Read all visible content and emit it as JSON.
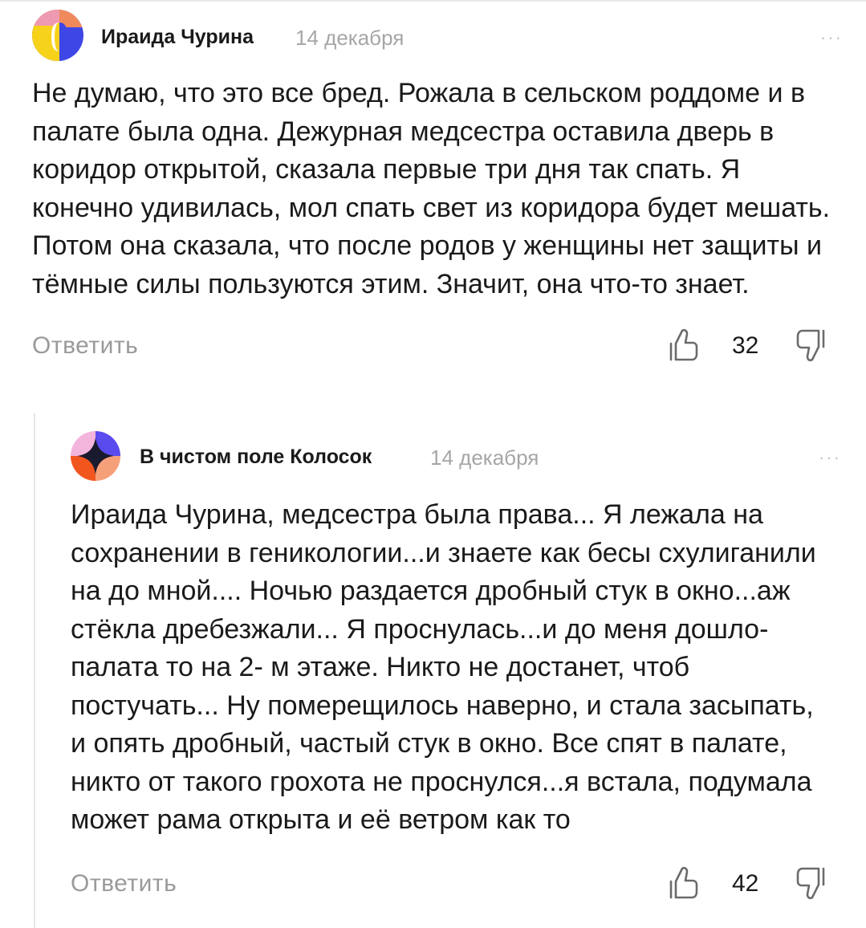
{
  "comments": [
    {
      "author": "Ираида Чурина",
      "date": "14 декабря",
      "more": "···",
      "text": "Не думаю, что это все бред. Рожала в сельском роддоме и в палате была одна. Дежурная медсестра оставила дверь в коридор открытой, сказала первые три дня так спать. Я конечно удивилась, мол спать свет из коридора будет мешать. Потом она сказала, что после родов у женщины нет защиты и тёмные силы пользуются этим. Значит, она что-то знает.",
      "reply_label": "Ответить",
      "likes": "32",
      "avatar_icon": "multicolor-circle-avatar",
      "colors": {
        "yellow": "#f7d21a",
        "blue": "#3f46e6",
        "orange": "#f08a5d",
        "pink": "#ee9ab0"
      }
    },
    {
      "author": "В чистом поле Колосок",
      "date": "14 декабря",
      "more": "···",
      "text": "Ираида Чурина, медсестра была права... Я лежала на сохранении в геникологии...и знаете как бесы схулиганили на до мной.... Ночью раздается дробный стук в окно...аж стёкла дребезжали... Я проснулась...и до меня дошло- палата то на 2- м этаже. Никто не достанет, чтоб постучать... Ну померещилось наверно, и стала засыпать, и опять дробный, частый стук в окно. Все спят в палате, никто от такого грохота не проснулся...я встала, подумала может рама открыта и её ветром как то",
      "reply_label": "Ответить",
      "likes": "42",
      "avatar_icon": "star-circle-avatar",
      "colors": {
        "pink": "#f3b5dc",
        "purple": "#5a4bee",
        "orange": "#f2561f",
        "peach": "#f6a07a"
      }
    }
  ]
}
